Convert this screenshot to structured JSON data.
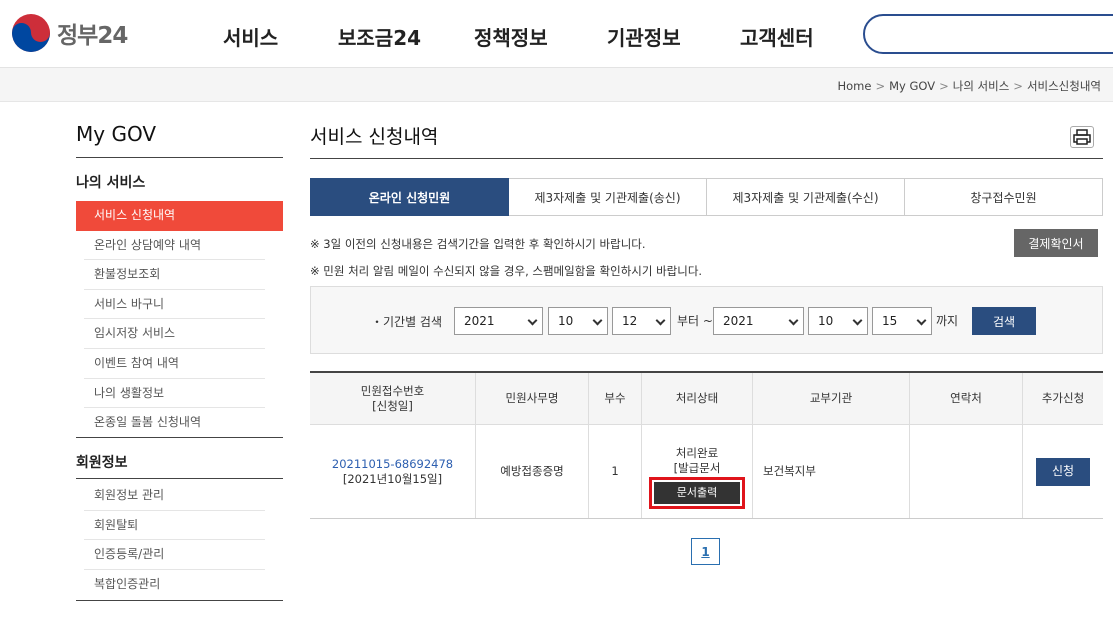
{
  "header": {
    "logo_text": "정부24",
    "nav": [
      "서비스",
      "보조금24",
      "정책정보",
      "기관정보",
      "고객센터"
    ]
  },
  "breadcrumb": [
    "Home",
    "My GOV",
    "나의 서비스",
    "서비스신청내역"
  ],
  "sidebar": {
    "title": "My GOV",
    "group1": "나의 서비스",
    "group1_items": [
      "서비스 신청내역",
      "온라인 상담예약 내역",
      "환불정보조회",
      "서비스 바구니",
      "임시저장 서비스",
      "이벤트 참여 내역",
      "나의 생활정보",
      "온종일 돌봄 신청내역"
    ],
    "group2": "회원정보",
    "group2_items": [
      "회원정보 관리",
      "회원탈퇴",
      "인증등록/관리",
      "복합인증관리"
    ]
  },
  "main": {
    "title": "서비스 신청내역",
    "tabs": [
      "온라인 신청민원",
      "제3자제출 및 기관제출(송신)",
      "제3자제출 및 기관제출(수신)",
      "창구접수민원"
    ],
    "notice1": "※ 3일 이전의 신청내용은 검색기간을 입력한 후 확인하시기 바랍니다.",
    "notice2": "※ 민원 처리 알림 메일이 수신되지 않을 경우, 스팸메일함을 확인하시기 바랍니다.",
    "pay_button": "결제확인서",
    "search": {
      "label": "・기간별 검색",
      "from_year": "2021",
      "from_month": "10",
      "from_day": "12",
      "from_word": "부터 ~",
      "to_year": "2021",
      "to_month": "10",
      "to_day": "15",
      "to_word": "까지",
      "button": "검색"
    },
    "table": {
      "headers": [
        "민원접수번호\n[신청일]",
        "민원사무명",
        "부수",
        "처리상태",
        "교부기관",
        "연락처",
        "추가신청"
      ],
      "row": {
        "number": "20211015-68692478",
        "date": "[2021년10월15일]",
        "name": "예방접종증명",
        "copies": "1",
        "status": "처리완료\n[발급문서\n등록완료]",
        "print_button": "문서출력",
        "agency": "보건복지부",
        "contact": "",
        "apply_button": "신청"
      }
    },
    "page": "1"
  },
  "colors": {
    "primary": "#2a4d7f",
    "active_menu": "#f04a3a",
    "highlight_box": "#e0141b"
  }
}
